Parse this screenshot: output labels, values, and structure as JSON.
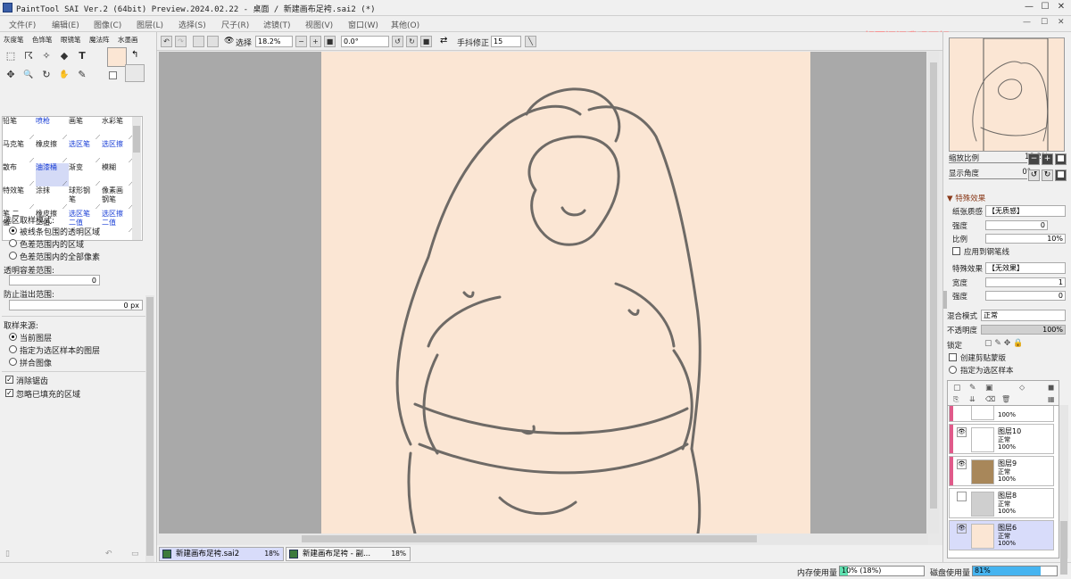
{
  "title_bar": {
    "title": "PaintTool SAI Ver.2 (64bit) Preview.2024.02.22 - 桌面 / 新建画布足袴.sai2 (*)",
    "min": "—",
    "max": "☐",
    "close": "✕"
  },
  "menu": [
    "文件(F)",
    "编辑(E)",
    "图像(C)",
    "图层(L)",
    "选择(S)",
    "尺子(R)",
    "滤镜(T)",
    "视图(V)",
    "窗口(W)",
    "其他(O)"
  ],
  "menu_right": {
    "min": "—",
    "max": "☐",
    "close": "✕"
  },
  "watermark": "想要问问我吗不好",
  "brush_tabs": [
    "灰度笔",
    "色饰笔",
    "眼镜笔",
    "魔法阵",
    "水墨画"
  ],
  "tool_icons": [
    "selection-rect-icon",
    "lasso-icon",
    "magic-wand-icon",
    "bucket-icon",
    "text-icon",
    "move-icon",
    "zoom-icon",
    "rotate-icon",
    "hand-icon",
    "eyedropper-icon"
  ],
  "tool_glyphs": [
    "⬚",
    "☈",
    "✧",
    "◆",
    "T",
    "✥",
    "🔍",
    "↻",
    "✋",
    "✎"
  ],
  "brush_grid": [
    {
      "label": "铅笔",
      "blue": false,
      "sel": false
    },
    {
      "label": "喷枪",
      "blue": true,
      "sel": false
    },
    {
      "label": "画笔",
      "blue": false,
      "sel": false
    },
    {
      "label": "水彩笔",
      "blue": false,
      "sel": false
    },
    {
      "label": "马克笔",
      "blue": false,
      "sel": false
    },
    {
      "label": "橡皮擦",
      "blue": false,
      "sel": false
    },
    {
      "label": "选区笔",
      "blue": true,
      "sel": false
    },
    {
      "label": "选区擦",
      "blue": true,
      "sel": false
    },
    {
      "label": "散布",
      "blue": false,
      "sel": false
    },
    {
      "label": "油漆桶",
      "blue": true,
      "sel": true
    },
    {
      "label": "渐变",
      "blue": false,
      "sel": false
    },
    {
      "label": "模糊",
      "blue": false,
      "sel": false
    },
    {
      "label": "特效笔",
      "blue": false,
      "sel": false
    },
    {
      "label": "涂抹",
      "blue": false,
      "sel": false
    },
    {
      "label": "球形钢笔",
      "blue": false,
      "sel": false
    },
    {
      "label": "像素画 钢笔",
      "blue": false,
      "sel": false
    },
    {
      "label": "笔 二值",
      "blue": false,
      "sel": false
    },
    {
      "label": "橡皮擦 二值",
      "blue": false,
      "sel": false
    },
    {
      "label": "选区笔 二值",
      "blue": true,
      "sel": false
    },
    {
      "label": "选区擦 二值",
      "blue": true,
      "sel": false
    }
  ],
  "options": {
    "sample_mode_title": "选区取样模式:",
    "sample_modes": [
      {
        "label": "被线条包围的透明区域",
        "on": true
      },
      {
        "label": "色差范围内的区域",
        "on": false
      },
      {
        "label": "色差范围内的全部像素",
        "on": false
      }
    ],
    "tolerance_title": "透明容差范围:",
    "tolerance_value": "0",
    "overflow_title": "防止溢出范围:",
    "overflow_value": "0 px",
    "source_title": "取样来源:",
    "sources": [
      {
        "label": "当前图层",
        "on": true
      },
      {
        "label": "指定为选区样本的图层",
        "on": false
      },
      {
        "label": "拼合图像",
        "on": false
      }
    ],
    "checks": [
      {
        "label": "消除锯齿",
        "on": true
      },
      {
        "label": "忽略已填充的区域",
        "on": true
      }
    ]
  },
  "toolbar": {
    "select_label": "选择",
    "zoom": "18.2%",
    "angle": "0.0°",
    "stabilizer_label": "手抖修正",
    "stabilizer": "15"
  },
  "doc_tabs": [
    {
      "name": "新建画布足袴.sai2",
      "pct": "18%",
      "active": true
    },
    {
      "name": "新建画布足袴 - 副...",
      "pct": "18%",
      "active": false
    }
  ],
  "status": {
    "mem_label": "内存使用量",
    "mem_value": "10% (18%)",
    "mem_pct": 10,
    "disk_label": "磁盘使用量",
    "disk_value": "81%",
    "disk_pct": 81
  },
  "navigator": {
    "zoom_label": "缩放比例",
    "zoom": "18.2%",
    "angle_label": "显示角度",
    "angle": "0°"
  },
  "effects": {
    "title": "特殊效果",
    "paper_label": "纸张质感",
    "paper_value": "【无质感】",
    "strength_label": "强度",
    "strength_value": "0",
    "scale_label": "比例",
    "scale_value": "10%",
    "apply_pen_label": "应用到钢笔线",
    "effect_label": "特殊效果",
    "effect_value": "【无效果】",
    "width_label": "宽度",
    "width_value": "1",
    "strength2_label": "强度",
    "strength2_value": "0"
  },
  "blend": {
    "mode_label": "混合模式",
    "mode_value": "正常",
    "opacity_label": "不透明度",
    "opacity_value": "100%",
    "lock_label": "锁定",
    "clip_label": "创建剪贴蒙版",
    "sample_label": "指定为选区样本"
  },
  "layers": [
    {
      "name": "",
      "mode": "",
      "opacity": "100%",
      "tagged": true,
      "thumb": "#ffffff",
      "visible": true,
      "selected": false
    },
    {
      "name": "图层10",
      "mode": "正常",
      "opacity": "100%",
      "tagged": true,
      "thumb": "#ffffff",
      "visible": true,
      "selected": false
    },
    {
      "name": "图层9",
      "mode": "正常",
      "opacity": "100%",
      "tagged": true,
      "thumb": "#a8875a",
      "visible": true,
      "selected": false
    },
    {
      "name": "图层8",
      "mode": "正常",
      "opacity": "100%",
      "tagged": false,
      "thumb": "#cfcfcf",
      "visible": false,
      "selected": false
    },
    {
      "name": "图层6",
      "mode": "正常",
      "opacity": "100%",
      "tagged": false,
      "thumb": "#fbe6d4",
      "visible": true,
      "selected": true
    }
  ],
  "colors": {
    "canvas": "#fbe6d4",
    "accent_tag": "#e05a8a",
    "mem_fill": "#5fe0b0",
    "disk_fill": "#46b4f0",
    "selected_layer": "#d8dcfa"
  }
}
